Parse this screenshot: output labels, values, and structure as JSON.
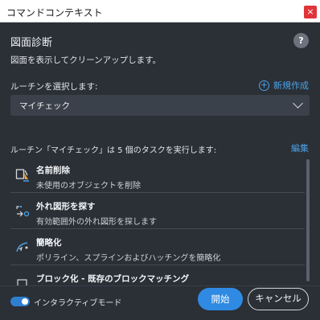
{
  "window": {
    "title": "コマンドコンテキスト",
    "close_glyph": "×"
  },
  "header": {
    "heading": "図面診断",
    "help_glyph": "?",
    "description": "図面を表示してクリーンアップします。"
  },
  "routine": {
    "select_label": "ルーチンを選択します:",
    "new_label": "新規作成",
    "new_icon": "plus-circle-icon",
    "selected": "マイチェック"
  },
  "tasks": {
    "summary": "ルーチン「マイチェック」は 5 個のタスクを実行します:",
    "edit_label": "編集",
    "items": [
      {
        "name": "名前削除",
        "desc": "未使用のオブジェクトを削除",
        "icon": "purge-icon"
      },
      {
        "name": "外れ図形を探す",
        "desc": "有効範囲外の外れ図形を探します",
        "icon": "find-outliers-icon"
      },
      {
        "name": "簡略化",
        "desc": "ポリライン、スプラインおよびハッチングを簡略化",
        "icon": "simplify-icon"
      },
      {
        "name": "ブロック化 - 既存のブロックマッチング",
        "desc": "",
        "icon": "block-icon"
      }
    ]
  },
  "footer": {
    "mode_label": "インタラクティブモード",
    "mode_on": true,
    "start_label": "開始",
    "cancel_label": "キャンセル"
  },
  "colors": {
    "accent": "#2f8ae3",
    "link": "#4aa3e8",
    "close": "#e0343a",
    "background": "#2b2f36"
  }
}
